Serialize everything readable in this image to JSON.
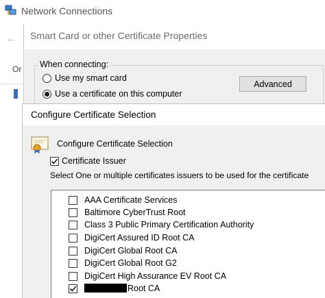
{
  "network_window": {
    "title": "Network Connections",
    "side_text": "Or"
  },
  "smartcard_dialog": {
    "title": "Smart Card or other Certificate Properties",
    "group_label": "When connecting:",
    "options": [
      {
        "label": "Use my smart card",
        "selected": false
      },
      {
        "label": "Use a certificate on this computer",
        "selected": true
      }
    ],
    "advanced_button": "Advanced"
  },
  "config_dialog": {
    "title": "Configure Certificate Selection",
    "heading": "Configure Certificate Selection",
    "issuer_checkbox": {
      "label": "Certificate Issuer",
      "checked": true
    },
    "instruction": "Select One or multiple certificates issuers to be used for the certificate",
    "issuers": [
      {
        "label": "AAA Certificate Services",
        "checked": false
      },
      {
        "label": "Baltimore CyberTrust Root",
        "checked": false
      },
      {
        "label": "Class 3 Public Primary Certification Authority",
        "checked": false
      },
      {
        "label": "DigiCert Assured ID Root CA",
        "checked": false
      },
      {
        "label": "DigiCert Global Root CA",
        "checked": false
      },
      {
        "label": "DigiCert Global Root G2",
        "checked": false
      },
      {
        "label": "DigiCert High Assurance EV Root CA",
        "checked": false
      },
      {
        "label": "Root CA",
        "checked": true,
        "redacted_prefix": true
      }
    ]
  }
}
